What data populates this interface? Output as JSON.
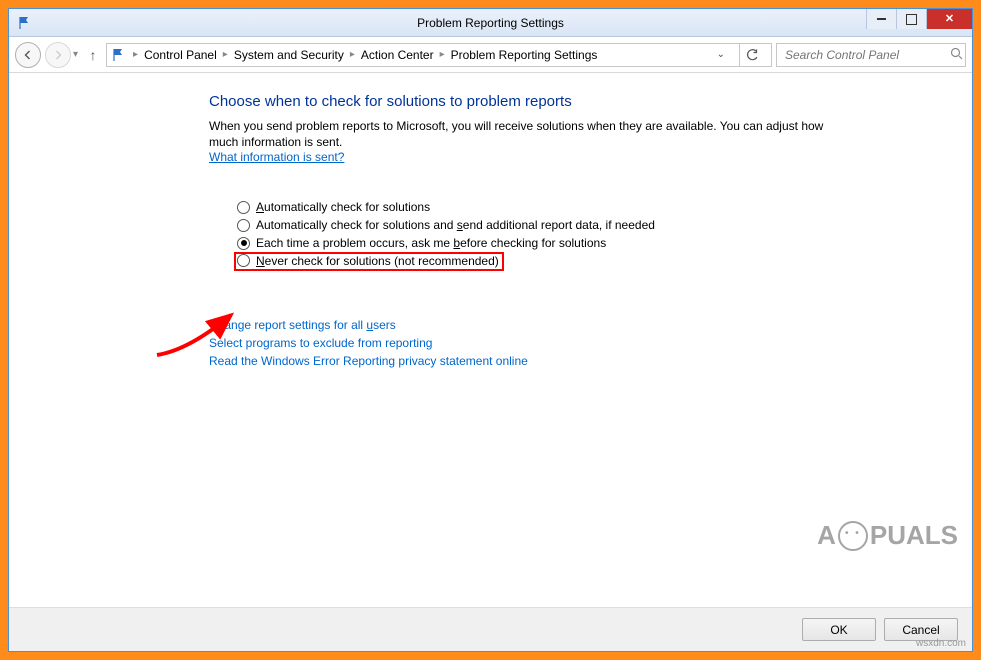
{
  "window": {
    "title": "Problem Reporting Settings"
  },
  "breadcrumb": {
    "items": [
      "Control Panel",
      "System and Security",
      "Action Center",
      "Problem Reporting Settings"
    ]
  },
  "search": {
    "placeholder": "Search Control Panel"
  },
  "page": {
    "heading": "Choose when to check for solutions to problem reports",
    "description": "When you send problem reports to Microsoft, you will receive solutions when they are available. You can adjust how much information is sent.",
    "info_link": "What information is sent?"
  },
  "options": {
    "opt1_pre": "A",
    "opt1_rest": "utomatically check for solutions",
    "opt2_a": "Automatically check for solutions and ",
    "opt2_u": "s",
    "opt2_b": "end additional report data, if needed",
    "opt3_a": "Each time a problem occurs, ask me ",
    "opt3_u": "b",
    "opt3_b": "efore checking for solutions",
    "opt4_u": "N",
    "opt4_rest": "ever check for solutions (not recommended)",
    "selected": 2
  },
  "links": {
    "l1_a": "Change report settings for all ",
    "l1_u": "u",
    "l1_b": "sers",
    "l2": "Select programs to exclude from reporting",
    "l3": "Read the Windows Error Reporting privacy statement online"
  },
  "footer": {
    "ok": "OK",
    "cancel": "Cancel"
  },
  "watermark": {
    "pre": "A",
    "post": "PUALS"
  },
  "credit": "wsxdn.com"
}
